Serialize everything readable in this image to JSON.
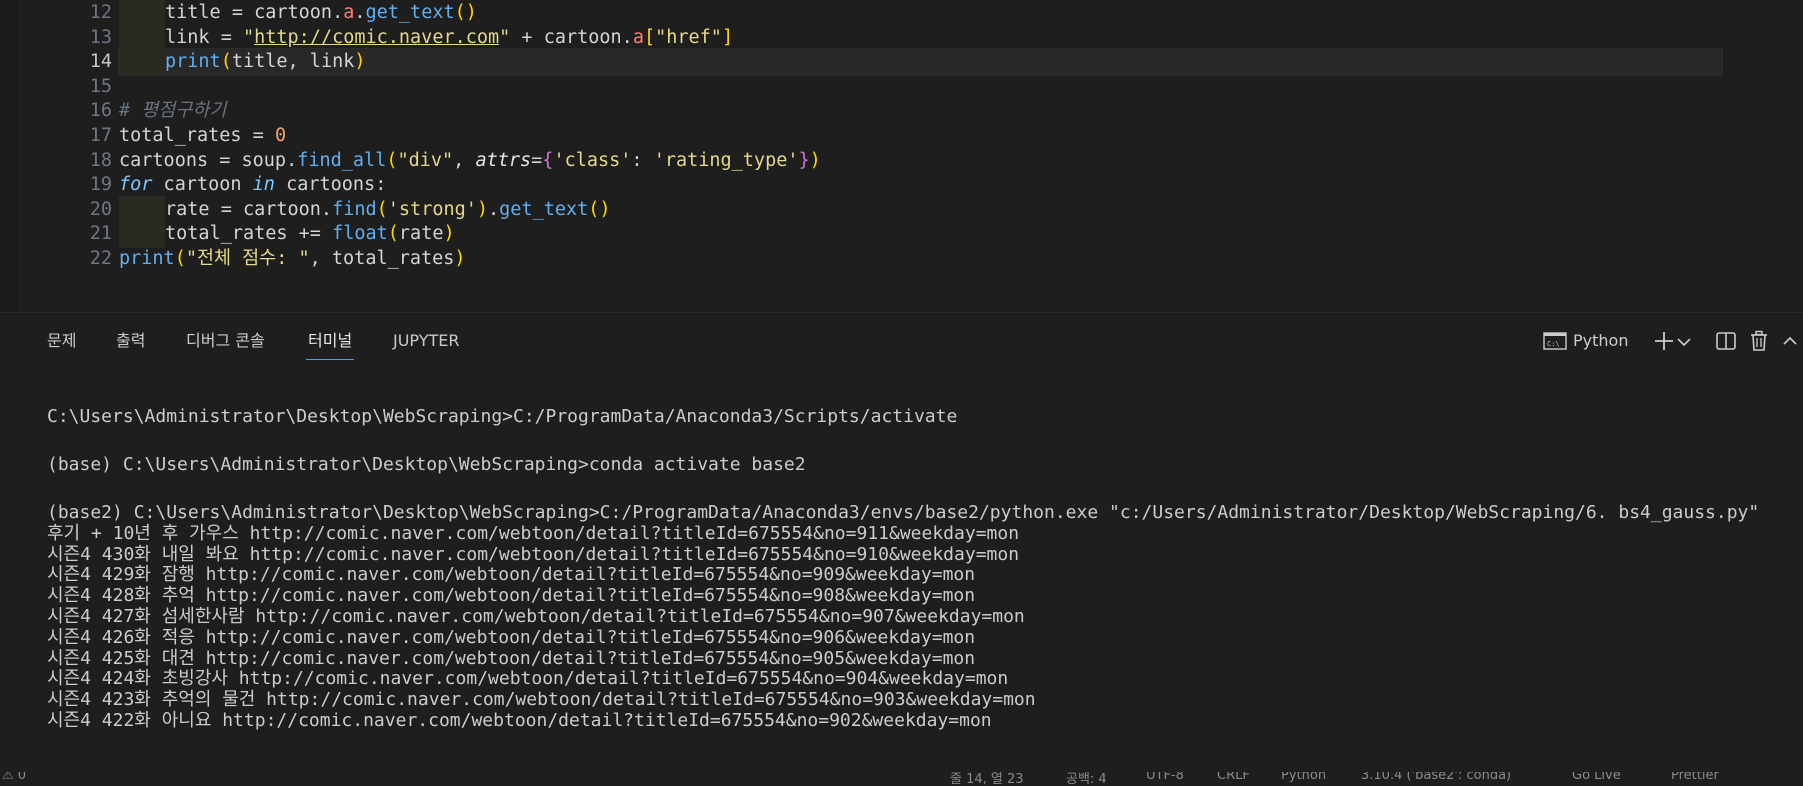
{
  "editor": {
    "lines": [
      {
        "num": "12",
        "indent": true,
        "tokens": [
          [
            "id",
            "title = cartoon."
          ],
          [
            "attr",
            "a"
          ],
          [
            "id",
            "."
          ],
          [
            "fn",
            "get_text"
          ],
          [
            "br1",
            "()"
          ]
        ]
      },
      {
        "num": "13",
        "indent": true,
        "tokens": [
          [
            "id",
            "link = "
          ],
          [
            "str",
            "\""
          ],
          [
            "url",
            "http://comic.naver.com"
          ],
          [
            "str",
            "\""
          ],
          [
            "id",
            " + cartoon."
          ],
          [
            "attr",
            "a"
          ],
          [
            "br1",
            "["
          ],
          [
            "str",
            "\"href\""
          ],
          [
            "br1",
            "]"
          ]
        ]
      },
      {
        "num": "14",
        "indent": true,
        "current": true,
        "tokens": [
          [
            "fn",
            "print"
          ],
          [
            "br1",
            "("
          ],
          [
            "id",
            "title, link"
          ],
          [
            "br1",
            ")"
          ]
        ]
      },
      {
        "num": "15",
        "tokens": []
      },
      {
        "num": "16",
        "tokens": [
          [
            "cm",
            "# 평점구하기"
          ]
        ]
      },
      {
        "num": "17",
        "tokens": [
          [
            "id",
            "total_rates = "
          ],
          [
            "num",
            "0"
          ]
        ]
      },
      {
        "num": "18",
        "tokens": [
          [
            "id",
            "cartoons = soup."
          ],
          [
            "fn",
            "find_all"
          ],
          [
            "br1",
            "("
          ],
          [
            "str",
            "\"div\""
          ],
          [
            "id",
            ", "
          ],
          [
            "kwarg",
            "attrs"
          ],
          [
            "op",
            "="
          ],
          [
            "br2",
            "{"
          ],
          [
            "str",
            "'class'"
          ],
          [
            "id",
            ": "
          ],
          [
            "str",
            "'rating_type'"
          ],
          [
            "br2",
            "}"
          ],
          [
            "br1",
            ")"
          ]
        ]
      },
      {
        "num": "19",
        "tokens": [
          [
            "kw",
            "for"
          ],
          [
            "id",
            " cartoon "
          ],
          [
            "kw",
            "in"
          ],
          [
            "id",
            " cartoons:"
          ]
        ]
      },
      {
        "num": "20",
        "indent": true,
        "tokens": [
          [
            "id",
            "rate = cartoon."
          ],
          [
            "fn",
            "find"
          ],
          [
            "br1",
            "("
          ],
          [
            "str",
            "'strong'"
          ],
          [
            "br1",
            ")"
          ],
          [
            "id",
            "."
          ],
          [
            "fn",
            "get_text"
          ],
          [
            "br1",
            "()"
          ]
        ]
      },
      {
        "num": "21",
        "indent": true,
        "tokens": [
          [
            "id",
            "total_rates += "
          ],
          [
            "fn",
            "float"
          ],
          [
            "br1",
            "("
          ],
          [
            "id",
            "rate"
          ],
          [
            "br1",
            ")"
          ]
        ]
      },
      {
        "num": "22",
        "tokens": [
          [
            "fn",
            "print"
          ],
          [
            "br1",
            "("
          ],
          [
            "str",
            "\"전체 점수: \""
          ],
          [
            "id",
            ", total_rates"
          ],
          [
            "br1",
            ")"
          ]
        ]
      }
    ]
  },
  "panel": {
    "tabs": [
      {
        "label": "문제"
      },
      {
        "label": "출력"
      },
      {
        "label": "디버그 콘솔"
      },
      {
        "label": "터미널",
        "active": true
      },
      {
        "label": "JUPYTER"
      }
    ],
    "terminal_profile": "Python",
    "icons": [
      "terminal-icon",
      "plus-icon",
      "chevron-down-icon",
      "split-icon",
      "trash-icon",
      "chevron-up-icon"
    ]
  },
  "terminal": {
    "lines": [
      "C:\\Users\\Administrator\\Desktop\\WebScraping>C:/ProgramData/Anaconda3/Scripts/activate",
      "",
      "(base) C:\\Users\\Administrator\\Desktop\\WebScraping>conda activate base2",
      "",
      "(base2) C:\\Users\\Administrator\\Desktop\\WebScraping>C:/ProgramData/Anaconda3/envs/base2/python.exe \"c:/Users/Administrator/Desktop/WebScraping/6. bs4_gauss.py\"",
      "후기 + 10년 후 가우스 http://comic.naver.com/webtoon/detail?titleId=675554&no=911&weekday=mon",
      "시즌4 430화 내일 봐요 http://comic.naver.com/webtoon/detail?titleId=675554&no=910&weekday=mon",
      "시즌4 429화 잠행 http://comic.naver.com/webtoon/detail?titleId=675554&no=909&weekday=mon",
      "시즌4 428화 추억 http://comic.naver.com/webtoon/detail?titleId=675554&no=908&weekday=mon",
      "시즌4 427화 섬세한사람 http://comic.naver.com/webtoon/detail?titleId=675554&no=907&weekday=mon",
      "시즌4 426화 적응 http://comic.naver.com/webtoon/detail?titleId=675554&no=906&weekday=mon",
      "시즌4 425화 대견 http://comic.naver.com/webtoon/detail?titleId=675554&no=905&weekday=mon",
      "시즌4 424화 초빙강사 http://comic.naver.com/webtoon/detail?titleId=675554&no=904&weekday=mon",
      "시즌4 423화 추억의 물건 http://comic.naver.com/webtoon/detail?titleId=675554&no=903&weekday=mon",
      "시즌4 422화 아니요 http://comic.naver.com/webtoon/detail?titleId=675554&no=902&weekday=mon"
    ]
  },
  "statusbar": {
    "items": [
      "⚠ 0",
      "줄 14, 열 23",
      "공백: 4",
      "UTF-8",
      "CRLF",
      "Python",
      "3.10.4 ('base2': conda)",
      "Go Live",
      "Prettier"
    ]
  },
  "colors": {
    "background": "#1e1e1e",
    "accent": "#4ea0e6"
  }
}
